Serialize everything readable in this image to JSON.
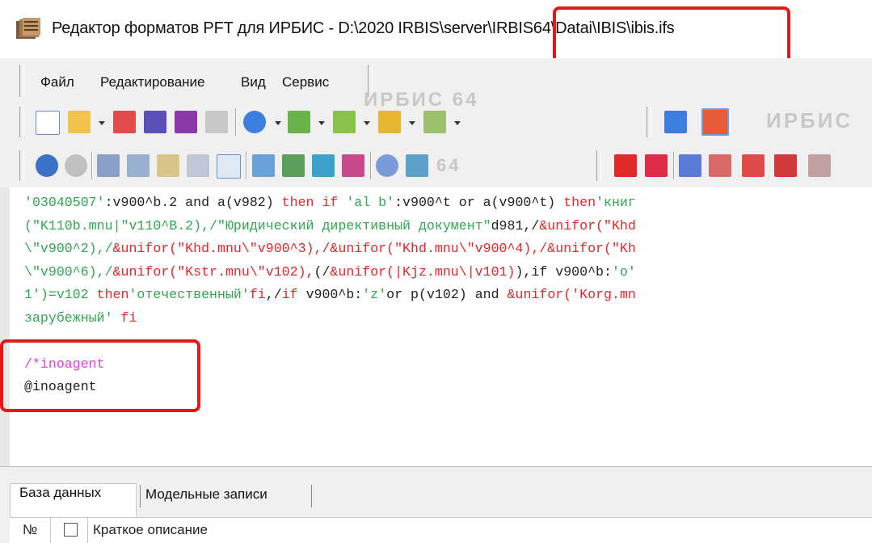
{
  "window": {
    "title": "Редактор форматов PFT для ИРБИС - D:\\2020 IRBIS\\server\\IRBIS64\\Datai\\IBIS\\ibis.ifs"
  },
  "menu": {
    "items": [
      {
        "label": "Файл"
      },
      {
        "label": "Редактирование"
      },
      {
        "label": "Вид"
      },
      {
        "label": "Сервис"
      }
    ]
  },
  "toolbar": {
    "watermark1": "ИРБИС 64",
    "watermark2": "ИРБИС",
    "watermark3": "64"
  },
  "editor": {
    "lines": [
      {
        "parts": [
          {
            "t": "'03040507'",
            "c": "g"
          },
          {
            "t": ":v900^b.2 and a(v982) ",
            "c": "k"
          },
          {
            "t": "then if ",
            "c": "r"
          },
          {
            "t": "'al b'",
            "c": "g"
          },
          {
            "t": ":v900^t or a(v900^t) ",
            "c": "k"
          },
          {
            "t": "then",
            "c": "r"
          },
          {
            "t": "'книг",
            "c": "g"
          }
        ]
      },
      {
        "parts": [
          {
            "t": "(\"K110b.mnu|\"v110^B.2),/",
            "c": "g"
          },
          {
            "t": "\"Юридический директивный документ\"",
            "c": "g"
          },
          {
            "t": "d981,/",
            "c": "k"
          },
          {
            "t": "&unifor(\"Khd",
            "c": "r"
          }
        ]
      },
      {
        "parts": [
          {
            "t": "\\\"v900^2),/",
            "c": "g"
          },
          {
            "t": "&unifor(\"Khd.mnu\\\"v900^3),/",
            "c": "r"
          },
          {
            "t": "&unifor(\"Khd.mnu\\\"v900^4),/",
            "c": "r"
          },
          {
            "t": "&unifor(\"Kh",
            "c": "r"
          }
        ]
      },
      {
        "parts": [
          {
            "t": "\\\"v900^6),/",
            "c": "g"
          },
          {
            "t": "&unifor(\"Kstr.mnu\\\"v102),",
            "c": "r"
          },
          {
            "t": "(/",
            "c": "k"
          },
          {
            "t": "&unifor(|Kjz.mnu\\|v101)",
            "c": "r"
          },
          {
            "t": "),if v900^b:",
            "c": "k"
          },
          {
            "t": "'o'",
            "c": "g"
          }
        ]
      },
      {
        "parts": [
          {
            "t": "1')=v102 ",
            "c": "g"
          },
          {
            "t": "then",
            "c": "r"
          },
          {
            "t": "'отечественный'",
            "c": "g"
          },
          {
            "t": "fi",
            "c": "r"
          },
          {
            "t": ",/",
            "c": "k"
          },
          {
            "t": "if ",
            "c": "r"
          },
          {
            "t": "v900^b:",
            "c": "k"
          },
          {
            "t": "'z'",
            "c": "g"
          },
          {
            "t": "or p(v102) and ",
            "c": "k"
          },
          {
            "t": "&unifor('Korg.mn",
            "c": "r"
          }
        ]
      },
      {
        "parts": [
          {
            "t": "зарубежный'",
            "c": "g"
          },
          {
            "t": " fi",
            "c": "r"
          }
        ]
      },
      {
        "parts": []
      },
      {
        "parts": [
          {
            "t": "/*inoagent",
            "c": "m"
          }
        ]
      },
      {
        "parts": [
          {
            "t": "@inoagent",
            "c": "k"
          }
        ]
      }
    ]
  },
  "bottom": {
    "tabs": [
      {
        "label": "База данных"
      },
      {
        "label": "Модельные записи"
      }
    ],
    "list_header": {
      "number_label": "№",
      "description_label": "Краткое описание"
    }
  },
  "colors": {
    "highlight_box": "#e31919",
    "keyword": "#e8262a",
    "string": "#2fa84f",
    "comment": "#e040e0"
  }
}
